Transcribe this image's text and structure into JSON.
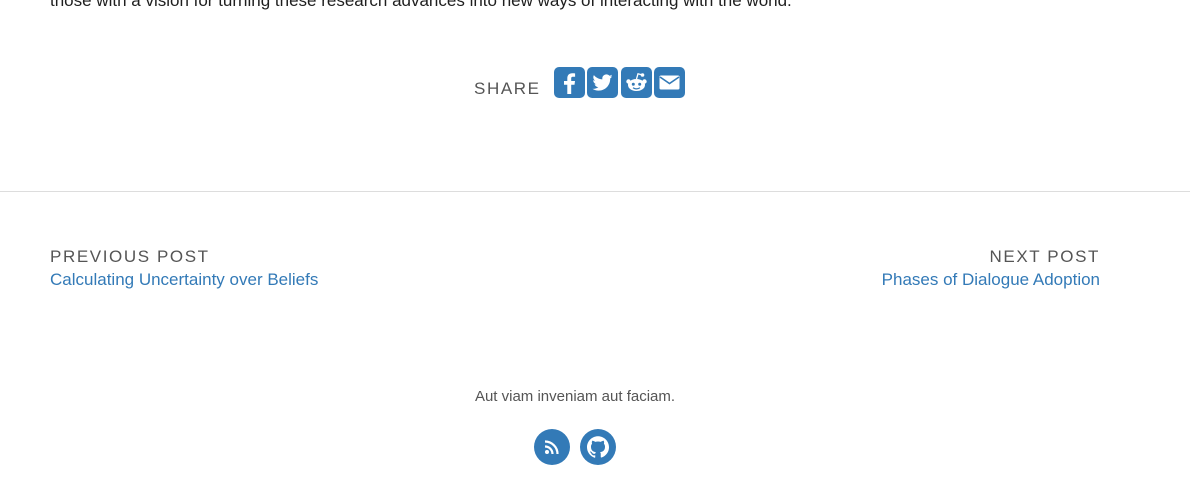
{
  "article": {
    "last_line": "those with a vision for turning these research advances into new ways of interacting with the world."
  },
  "share": {
    "label": "SHARE",
    "buttons": [
      {
        "icon": "facebook-icon"
      },
      {
        "icon": "twitter-icon"
      },
      {
        "icon": "reddit-icon"
      },
      {
        "icon": "envelope-icon"
      }
    ]
  },
  "pager": {
    "previous_heading": "PREVIOUS POST",
    "previous_title": "Calculating Uncertainty over Beliefs",
    "next_heading": "NEXT POST",
    "next_title": "Phases of Dialogue Adoption"
  },
  "footer": {
    "motto": "Aut viam inveniam aut faciam.",
    "icons": [
      {
        "icon": "rss-icon"
      },
      {
        "icon": "github-icon"
      }
    ]
  },
  "colors": {
    "accent": "#337ab7",
    "muted_text": "#555555",
    "divider": "#dddddd"
  }
}
